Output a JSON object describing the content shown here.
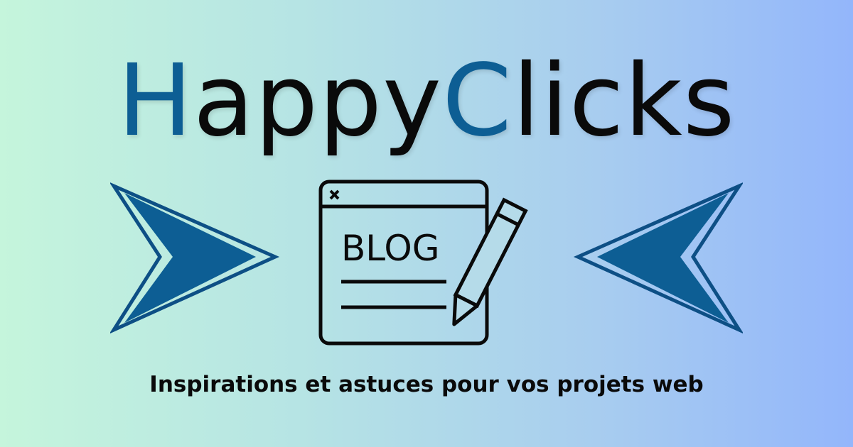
{
  "brand": {
    "part1_accent": "H",
    "part1_rest": "appy",
    "part2_accent": "C",
    "part2_rest": "licks",
    "accent_color": "#0d5e94"
  },
  "icon": {
    "name": "blog-pencil-icon",
    "label": "BLOG"
  },
  "arrows": {
    "left": "arrow-right-icon",
    "right": "arrow-left-icon",
    "color": "#0d5e94"
  },
  "tagline": "Inspirations et astuces pour vos projets web"
}
